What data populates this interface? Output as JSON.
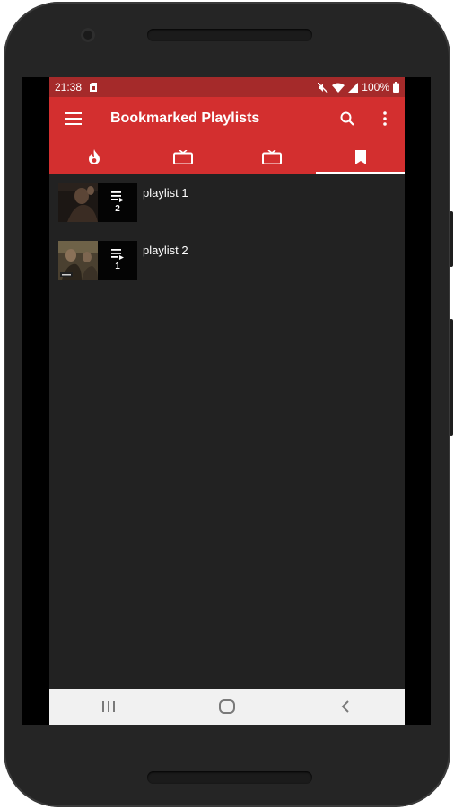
{
  "status_bar": {
    "time": "21:38",
    "battery": "100%"
  },
  "toolbar": {
    "title": "Bookmarked Playlists"
  },
  "tabs": [
    {
      "icon": "fire-icon",
      "active": false
    },
    {
      "icon": "tv-icon",
      "active": false
    },
    {
      "icon": "tv-icon",
      "active": false
    },
    {
      "icon": "bookmark-icon",
      "active": true
    }
  ],
  "playlists": [
    {
      "name": "playlist 1",
      "count": "2"
    },
    {
      "name": "playlist 2",
      "count": "1"
    }
  ],
  "colors": {
    "status_bar": "#a52a2a",
    "accent": "#d32f2f",
    "background": "#222222"
  }
}
